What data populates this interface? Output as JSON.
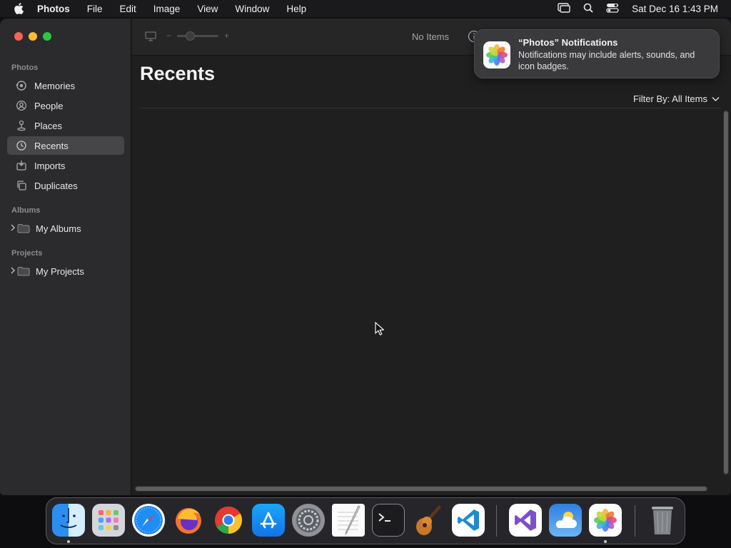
{
  "menubar": {
    "app_name": "Photos",
    "menus": [
      "File",
      "Edit",
      "Image",
      "View",
      "Window",
      "Help"
    ],
    "clock": "Sat Dec 16  1:43 PM"
  },
  "toolbar": {
    "item_count": "No Items"
  },
  "sidebar": {
    "sections": [
      {
        "label": "Photos"
      },
      {
        "label": "Albums"
      },
      {
        "label": "Projects"
      }
    ],
    "items": [
      {
        "label": "Memories",
        "icon": "memories-icon"
      },
      {
        "label": "People",
        "icon": "people-icon"
      },
      {
        "label": "Places",
        "icon": "places-icon"
      },
      {
        "label": "Recents",
        "icon": "clock-icon",
        "active": true
      },
      {
        "label": "Imports",
        "icon": "imports-icon"
      },
      {
        "label": "Duplicates",
        "icon": "duplicates-icon"
      },
      {
        "label": "My Albums",
        "icon": "folder-icon"
      },
      {
        "label": "My Projects",
        "icon": "folder-icon"
      }
    ]
  },
  "main": {
    "title": "Recents",
    "filter_label": "Filter By: All Items"
  },
  "notification": {
    "title": "“Photos” Notifications",
    "body": "Notifications may include alerts, sounds, and icon badges."
  },
  "dock": {
    "apps": [
      "Finder",
      "Launchpad",
      "Safari",
      "Firefox",
      "Chrome",
      "App Store",
      "System Settings",
      "TextEdit",
      "Terminal",
      "GarageBand",
      "Visual Studio Code",
      "Visual Studio",
      "Weather",
      "Photos",
      "Trash"
    ]
  }
}
